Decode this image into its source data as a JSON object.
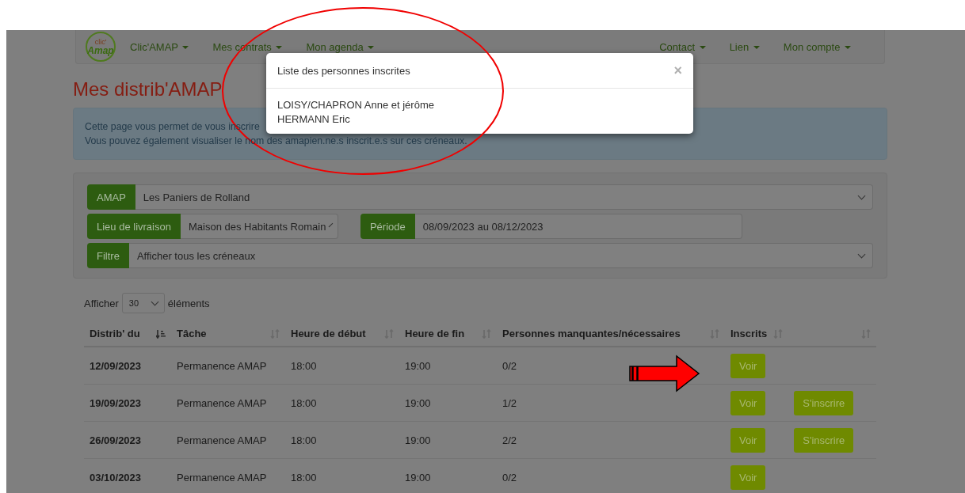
{
  "nav": {
    "logo": {
      "top": "clic'",
      "bottom": "Amap"
    },
    "left_menus": [
      {
        "label": "Clic'AMAP"
      },
      {
        "label": "Mes contrats"
      },
      {
        "label": "Mon agenda"
      }
    ],
    "right_menus": [
      {
        "label": "Contact"
      },
      {
        "label": "Lien"
      },
      {
        "label": "Mon compte"
      }
    ]
  },
  "title": "Mes distrib'AMAP",
  "alert": {
    "lines": [
      "Cette page vous permet de vous inscrire",
      "Vous pouvez également visualiser le nom des amapien.ne.s inscrit.e.s sur ces créneaux."
    ]
  },
  "filters": {
    "amap": {
      "label": "AMAP",
      "value": "Les Paniers de Rolland"
    },
    "lieu": {
      "label": "Lieu de livraison",
      "value": "Maison des Habitants Romain"
    },
    "periode": {
      "label": "Période",
      "value": "08/09/2023 au 08/12/2023"
    },
    "filtre": {
      "label": "Filtre",
      "value": "Afficher tous les créneaux"
    }
  },
  "length": {
    "before": "Afficher",
    "value": "30",
    "after": "éléments"
  },
  "table": {
    "columns": [
      {
        "label": "Distrib' du",
        "sorted": true
      },
      {
        "label": "Tâche",
        "sorted": false
      },
      {
        "label": "Heure de début",
        "sorted": false
      },
      {
        "label": "Heure de fin",
        "sorted": false
      },
      {
        "label": "Personnes manquantes/nécessaires",
        "sorted": false
      },
      {
        "label": "Inscrits",
        "sorted": false
      },
      {
        "sorted": false
      }
    ],
    "rows": [
      {
        "date": "12/09/2023",
        "task": "Permanence AMAP",
        "start": "18:00",
        "end": "19:00",
        "persons": "0/2",
        "view": "Voir"
      },
      {
        "date": "19/09/2023",
        "task": "Permanence AMAP",
        "start": "18:00",
        "end": "19:00",
        "persons": "1/2",
        "view": "Voir",
        "signup": "S'inscrire"
      },
      {
        "date": "26/09/2023",
        "task": "Permanence AMAP",
        "start": "18:00",
        "end": "19:00",
        "persons": "2/2",
        "view": "Voir",
        "signup": "S'inscrire"
      },
      {
        "date": "03/10/2023",
        "task": "Permanence AMAP",
        "start": "18:00",
        "end": "19:00",
        "persons": "0/2",
        "view": "Voir"
      }
    ]
  },
  "modal": {
    "title": "Liste des personnes inscrites",
    "close": "×",
    "people": [
      "LOISY/CHAPRON Anne et jérôme",
      "HERMANN Eric"
    ]
  }
}
